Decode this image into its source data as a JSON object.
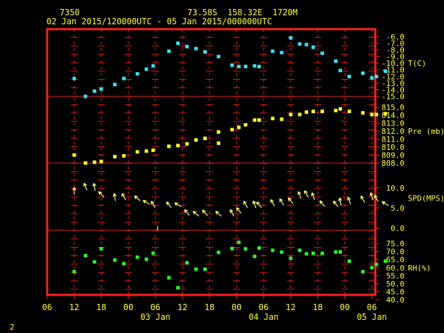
{
  "header": {
    "station_id": "7350",
    "location": "73.58S  158.32E  1720M",
    "time_range": "02 Jan 2015/120000UTC - 05 Jan 2015/000000UTC"
  },
  "page_number": "2",
  "colors": {
    "frame": "#ff2020",
    "grid": "#e02020",
    "text": "#ffff40",
    "temperature": "#40e0f0",
    "pressure": "#ffff30",
    "wind": "#ffff80",
    "humidity": "#30f030"
  },
  "chart_data": {
    "type": "scatter",
    "x_unit": "hours since 02 Jan 2015 06 UTC",
    "x_tick_labels": [
      "06",
      "12",
      "18",
      "00",
      "06",
      "12",
      "18",
      "00",
      "06",
      "12",
      "18",
      "00",
      "06"
    ],
    "date_labels": [
      {
        "label": "03 Jan",
        "hour": 24
      },
      {
        "label": "04 Jan",
        "hour": 48
      },
      {
        "label": "05 Jan",
        "hour": 72
      }
    ],
    "panels": [
      {
        "name": "temperature",
        "axis_label": "T(C)",
        "ylim": [
          -15,
          -5.5
        ],
        "ticks": [
          "-6.0",
          "-7.0",
          "-8.0",
          "-9.0",
          "-10.0",
          "-11.0",
          "-12.0",
          "-13.0",
          "-14.0",
          "-15.0"
        ],
        "tick_values": [
          -6,
          -7,
          -8,
          -9,
          -10,
          -11,
          -12,
          -13,
          -14,
          -15
        ],
        "label_value": -10,
        "marker": "square",
        "points": [
          [
            6,
            -12.3
          ],
          [
            8.5,
            -15.0
          ],
          [
            10.5,
            -14.2
          ],
          [
            12,
            -13.9
          ],
          [
            15,
            -13.2
          ],
          [
            17,
            -12.3
          ],
          [
            20,
            -11.6
          ],
          [
            22,
            -10.9
          ],
          [
            23.5,
            -10.4
          ],
          [
            27,
            -8.2
          ],
          [
            29,
            -7.0
          ],
          [
            31,
            -7.5
          ],
          [
            33,
            -7.8
          ],
          [
            35,
            -8.3
          ],
          [
            38,
            -9.0
          ],
          [
            41,
            -10.3
          ],
          [
            42.5,
            -10.5
          ],
          [
            44,
            -10.5
          ],
          [
            46,
            -10.4
          ],
          [
            47,
            -10.5
          ],
          [
            50,
            -8.2
          ],
          [
            52,
            -8.4
          ],
          [
            54,
            -6.2
          ],
          [
            56,
            -7.1
          ],
          [
            57.5,
            -7.2
          ],
          [
            59,
            -7.6
          ],
          [
            61,
            -8.5
          ],
          [
            64,
            -9.7
          ],
          [
            65,
            -11.1
          ],
          [
            67,
            -12.0
          ],
          [
            70,
            -11.5
          ],
          [
            72,
            -12.2
          ],
          [
            73,
            -12.0
          ],
          [
            75,
            -11.2
          ]
        ]
      },
      {
        "name": "pressure",
        "axis_label": "Pre (mb)",
        "ylim": [
          808,
          815.5
        ],
        "ticks": [
          "815.0",
          "814.0",
          "813.0",
          "812.0",
          "811.0",
          "810.0",
          "809.0",
          "808.0"
        ],
        "tick_values": [
          815,
          814,
          813,
          812,
          811,
          810,
          809,
          808
        ],
        "label_value": 812,
        "marker": "square",
        "points": [
          [
            6,
            809.0
          ],
          [
            8.5,
            808.0
          ],
          [
            10.5,
            808.1
          ],
          [
            12,
            808.2
          ],
          [
            15,
            808.8
          ],
          [
            17,
            808.9
          ],
          [
            20,
            809.4
          ],
          [
            22,
            809.5
          ],
          [
            23.5,
            809.6
          ],
          [
            27,
            810.1
          ],
          [
            29,
            810.2
          ],
          [
            31,
            810.4
          ],
          [
            33,
            810.9
          ],
          [
            35,
            811.1
          ],
          [
            38,
            811.9
          ],
          [
            41,
            812.2
          ],
          [
            42.5,
            812.5
          ],
          [
            44,
            812.8
          ],
          [
            46,
            813.4
          ],
          [
            47,
            813.4
          ],
          [
            50,
            813.6
          ],
          [
            52,
            813.5
          ],
          [
            54,
            814.1
          ],
          [
            56,
            814.1
          ],
          [
            57.5,
            814.4
          ],
          [
            59,
            814.5
          ],
          [
            61,
            814.5
          ],
          [
            64,
            814.6
          ],
          [
            65,
            814.8
          ],
          [
            67,
            814.5
          ],
          [
            70,
            814.3
          ],
          [
            72,
            814.1
          ],
          [
            73,
            814.1
          ],
          [
            75,
            814.2
          ],
          [
            38,
            810.5
          ]
        ]
      },
      {
        "name": "wind_speed",
        "axis_label": "SPD(MPS)",
        "ylim": [
          -0.5,
          11.5
        ],
        "ticks": [
          "10.0",
          "5.0",
          "0.0"
        ],
        "tick_values": [
          10,
          5,
          0
        ],
        "label_value": 7.5,
        "marker": "arrow",
        "points": [
          [
            6,
            9.2
          ],
          [
            8.5,
            10.3
          ],
          [
            10.5,
            10.2
          ],
          [
            12,
            8.4
          ],
          [
            15,
            7.7
          ],
          [
            17,
            7.8
          ],
          [
            20,
            7.4
          ],
          [
            22,
            6.4
          ],
          [
            23.5,
            5.9
          ],
          [
            27,
            5.8
          ],
          [
            29,
            5.8
          ],
          [
            31,
            3.9
          ],
          [
            33,
            3.6
          ],
          [
            35,
            3.8
          ],
          [
            38,
            3.6
          ],
          [
            41,
            3.8
          ],
          [
            42.5,
            4.4
          ],
          [
            44,
            5.9
          ],
          [
            46,
            5.9
          ],
          [
            47,
            5.8
          ],
          [
            50,
            6.3
          ],
          [
            52,
            6.5
          ],
          [
            54,
            6.8
          ],
          [
            56,
            8.2
          ],
          [
            57.5,
            8.5
          ],
          [
            59,
            7.9
          ],
          [
            61,
            6.1
          ],
          [
            64,
            6.0
          ],
          [
            65,
            6.6
          ],
          [
            67,
            6.8
          ],
          [
            70,
            7.2
          ],
          [
            72,
            7.9
          ],
          [
            73,
            7.4
          ],
          [
            75,
            6.1
          ]
        ],
        "directions_deg": [
          0,
          340,
          350,
          315,
          350,
          330,
          310,
          300,
          330,
          320,
          300,
          320,
          310,
          320,
          310,
          330,
          320,
          330,
          340,
          320,
          330,
          330,
          320,
          340,
          330,
          340,
          320,
          320,
          350,
          340,
          330,
          340,
          330,
          300
        ],
        "calm_marker_hour": 24.5
      },
      {
        "name": "relative_humidity",
        "axis_label": "RH(%)",
        "ylim": [
          40,
          78.5
        ],
        "ticks": [
          "75.0",
          "70.0",
          "65.0",
          "60.0",
          "55.0",
          "50.0",
          "45.0",
          "40.0"
        ],
        "tick_values": [
          75,
          70,
          65,
          60,
          55,
          50,
          45,
          40
        ],
        "label_value": 60,
        "marker": "square",
        "points": [
          [
            6,
            57.5
          ],
          [
            8.5,
            67.5
          ],
          [
            10.5,
            63.6
          ],
          [
            12,
            71.8
          ],
          [
            15,
            64.7
          ],
          [
            17,
            62.5
          ],
          [
            20,
            66.5
          ],
          [
            22,
            65.2
          ],
          [
            23.5,
            69.0
          ],
          [
            27,
            53.7
          ],
          [
            29,
            47.5
          ],
          [
            31,
            63.0
          ],
          [
            33,
            59.0
          ],
          [
            35,
            59.0
          ],
          [
            38,
            69.5
          ],
          [
            41,
            71.9
          ],
          [
            42.5,
            75.8
          ],
          [
            44,
            71.7
          ],
          [
            46,
            67.0
          ],
          [
            47,
            72.2
          ],
          [
            50,
            70.8
          ],
          [
            52,
            69.7
          ],
          [
            54,
            65.8
          ],
          [
            56,
            70.8
          ],
          [
            57.5,
            68.6
          ],
          [
            59,
            68.9
          ],
          [
            61,
            68.9
          ],
          [
            64,
            69.8
          ],
          [
            65,
            69.8
          ],
          [
            67,
            64.0
          ],
          [
            70,
            57.5
          ],
          [
            72,
            60.0
          ],
          [
            73,
            62.0
          ],
          [
            75,
            64.0
          ]
        ]
      }
    ]
  }
}
